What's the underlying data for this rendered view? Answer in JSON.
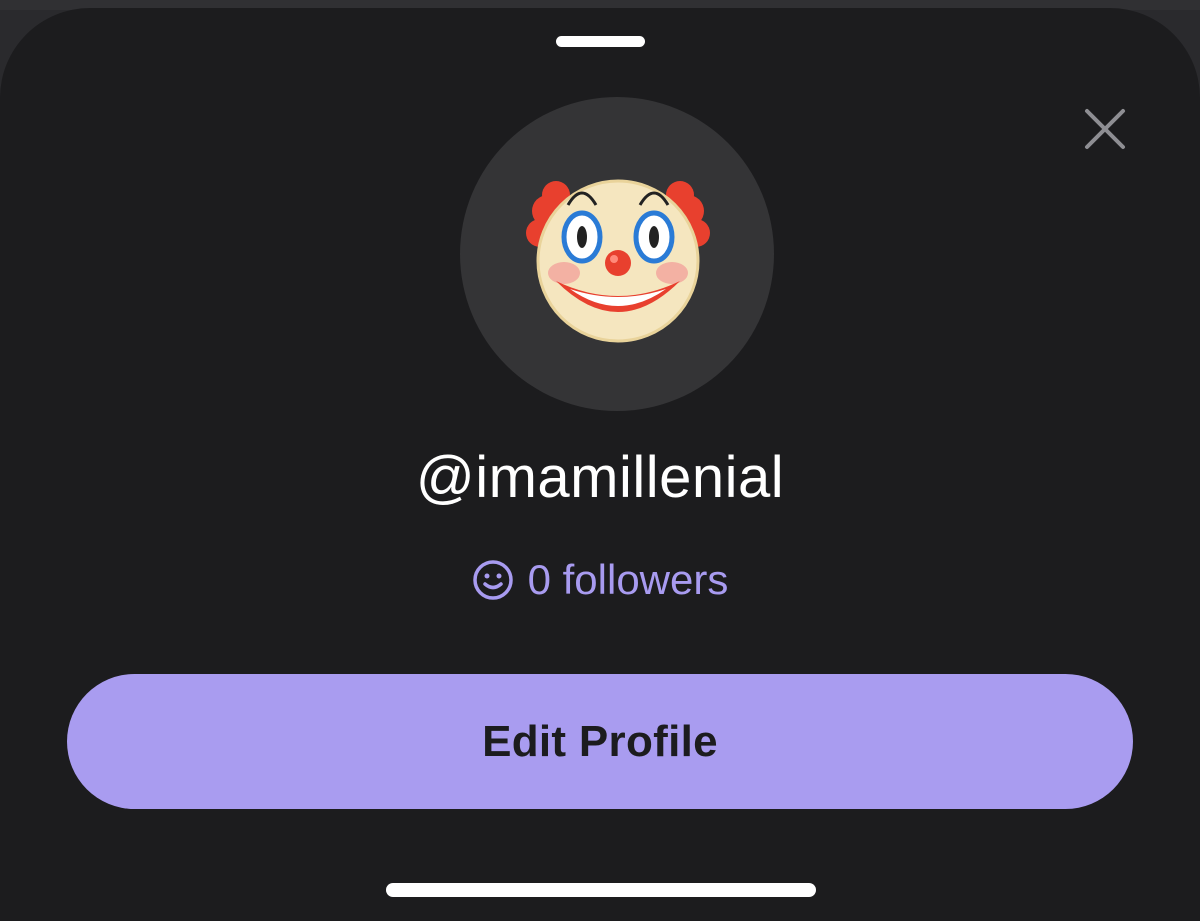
{
  "sheet": {
    "username": "@imamillenial",
    "followers": {
      "icon": "smiley-icon",
      "text": "0 followers"
    },
    "edit_button_label": "Edit Profile",
    "avatar": {
      "icon": "clown-face-emoji"
    },
    "close_icon": "close-icon"
  },
  "colors": {
    "sheet_background": "#1c1c1e",
    "avatar_background": "#343436",
    "accent": "#a99cf0",
    "followers_text": "#a89bf0",
    "username_text": "#ffffff"
  }
}
